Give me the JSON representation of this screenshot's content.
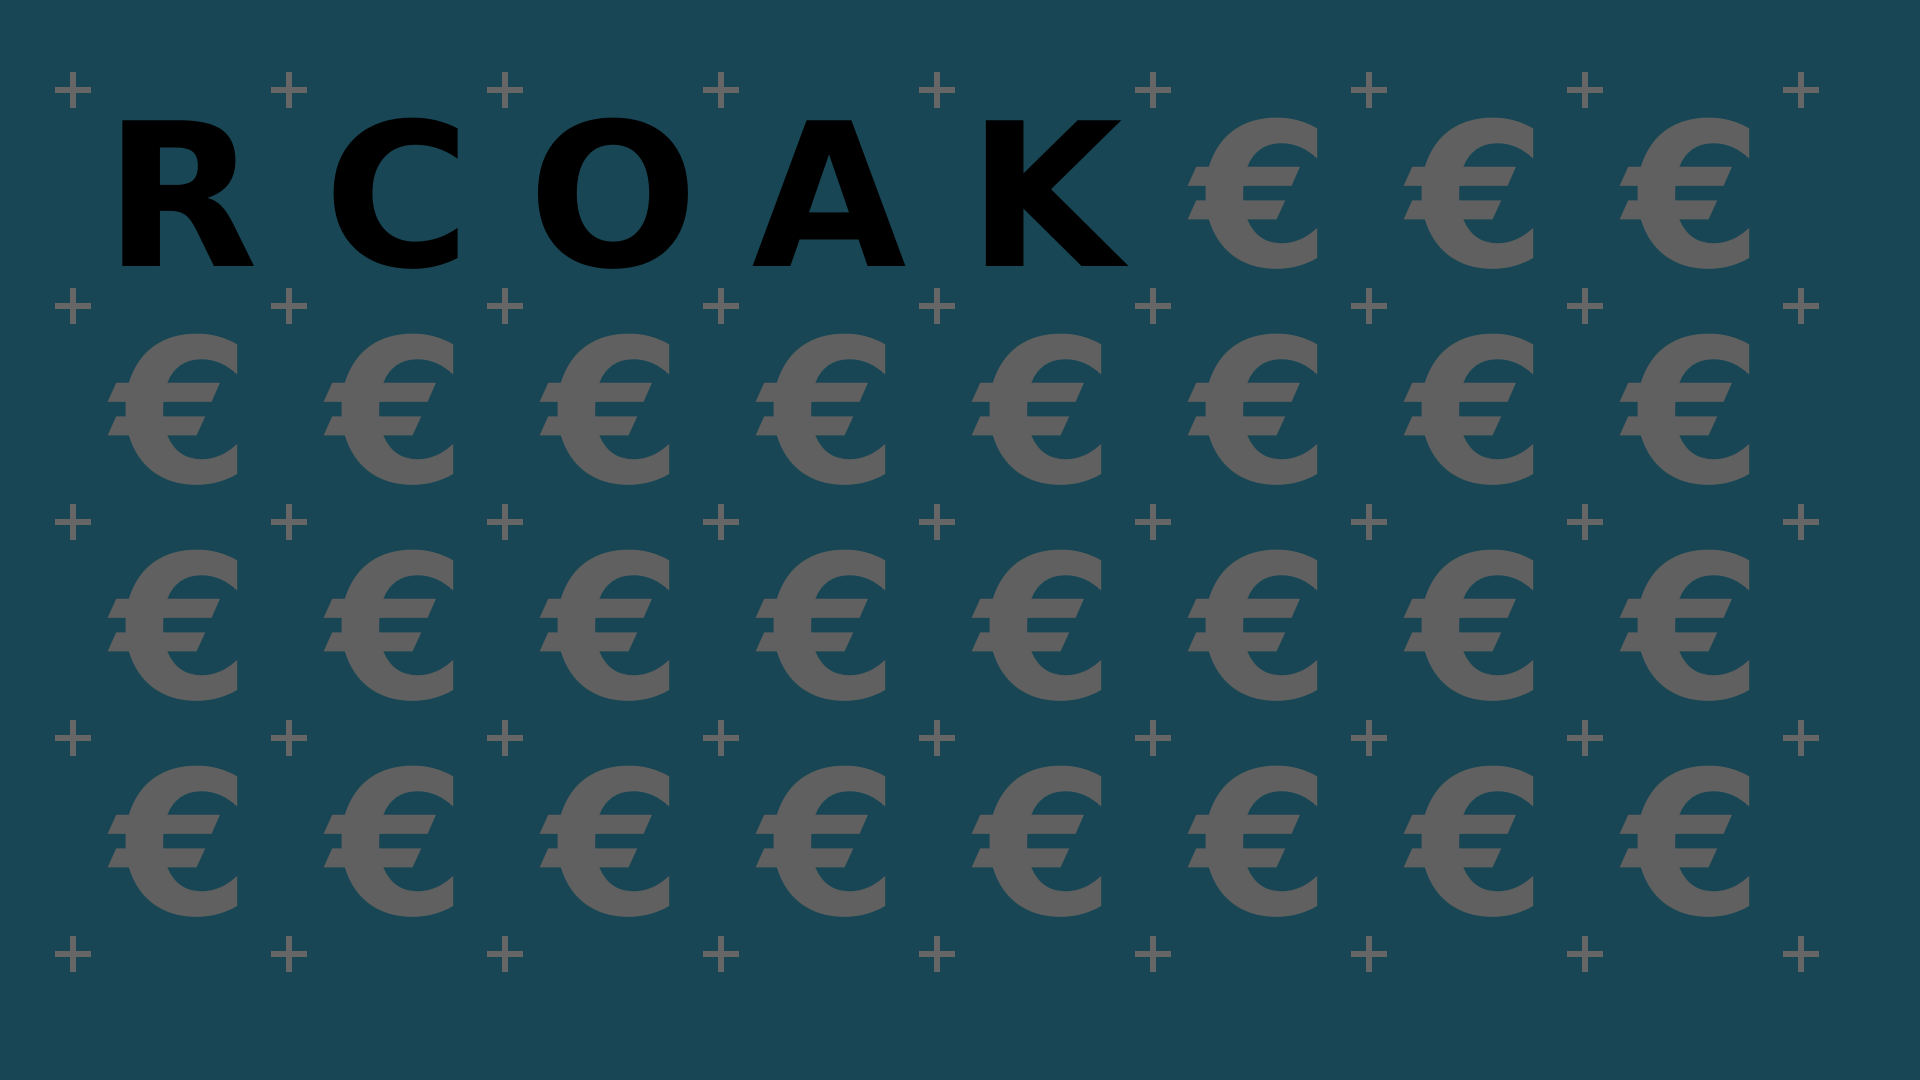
{
  "board": {
    "rows": 4,
    "cols": 8,
    "filled_letters": [
      "R",
      "C",
      "O",
      "A",
      "K"
    ],
    "empty_symbol": "€",
    "grid_marker": "plus-icon",
    "colors": {
      "background": "#184655",
      "letter": "#000000",
      "symbol": "#606060",
      "marker": "#666666"
    }
  }
}
